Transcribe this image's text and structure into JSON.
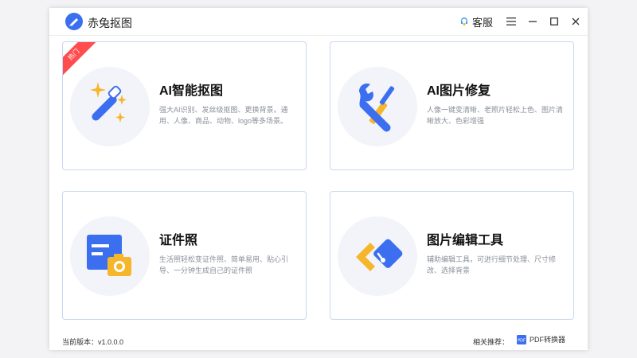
{
  "app": {
    "title": "赤兔抠图",
    "logo_icon": "app-logo-icon"
  },
  "titlebar": {
    "service_label": "客服",
    "service_icon": "headset-icon",
    "menu_icon": "menu-icon",
    "minimize_icon": "minimize-icon",
    "maximize_icon": "maximize-icon",
    "close_icon": "close-icon"
  },
  "cards": [
    {
      "title": "AI智能抠图",
      "description": "强大AI识别、发丝级抠图、更换背景。通用、人像、商品、动物、logo等多场景。",
      "badge": "热门",
      "icon": "magic-wand-icon"
    },
    {
      "title": "AI图片修复",
      "description": "人像一键变清晰、老照片轻松上色、图片清晰放大、色彩增强",
      "icon": "wrench-screwdriver-icon"
    },
    {
      "title": "证件照",
      "description": "生活照轻松变证件照、简单易用、贴心引导、一分钟生成自己的证件照",
      "icon": "id-photo-icon"
    },
    {
      "title": "图片编辑工具",
      "description": "辅助编辑工具，可进行细节处理、尺寸修改、选择背景",
      "icon": "edit-tool-icon"
    }
  ],
  "footer": {
    "version": "当前版本：v1.0.0.0",
    "recommend_label": "相关推荐：",
    "pdf_link": "PDF转换器",
    "pdf_icon": "pdf-icon"
  },
  "colors": {
    "accent": "#3c6ff0",
    "card_border": "#c9d7f0",
    "hot_badge": "#ff4d4f",
    "yellow": "#f5b62b"
  }
}
